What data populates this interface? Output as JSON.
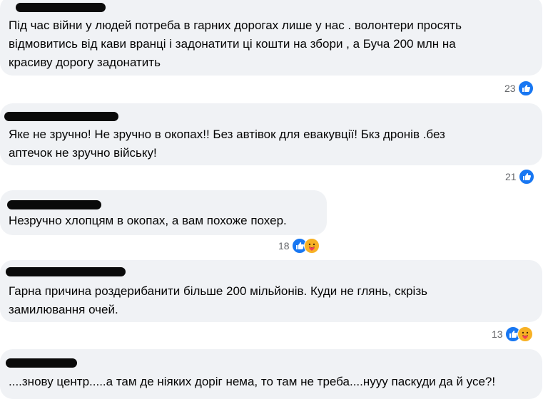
{
  "comments": [
    {
      "text_lines": [
        "Під час війни у людей потреба в гарних дорогах лише у нас . волонтери просять",
        "відмовитись від кави вранці і задонатити ці кошти на збори , а Буча 200 млн на",
        "красиву дорогу задонатить"
      ],
      "reaction_count": "23",
      "reactions": [
        "like-icon"
      ]
    },
    {
      "text_lines": [
        "Яке не зручно! Не зручно в окопах!! Без автівок для евакувції! Бкз дронів .без",
        "аптечок не зручно війську!"
      ],
      "reaction_count": "21",
      "reactions": [
        "like-icon"
      ]
    },
    {
      "text_lines": [
        "Незручно хлопцям в окопах, а вам похоже похер."
      ],
      "reaction_count": "18",
      "reactions": [
        "like-icon",
        "care-icon"
      ]
    },
    {
      "text_lines": [
        "Гарна причина роздерибанити більше 200 мільйонів. Куди не глянь, скрізь",
        "замилювання очей."
      ],
      "reaction_count": "13",
      "reactions": [
        "like-icon",
        "care-icon"
      ]
    },
    {
      "text_lines": [
        "....знову центр.....а там де ніяких доріг нема, то там не треба....нууу паскуди да й усе?!"
      ]
    }
  ],
  "colors": {
    "bubble": "#f0f2f5",
    "text": "#050505",
    "meta": "#65676b",
    "like": "#1877f2",
    "care": "#f7b125"
  }
}
